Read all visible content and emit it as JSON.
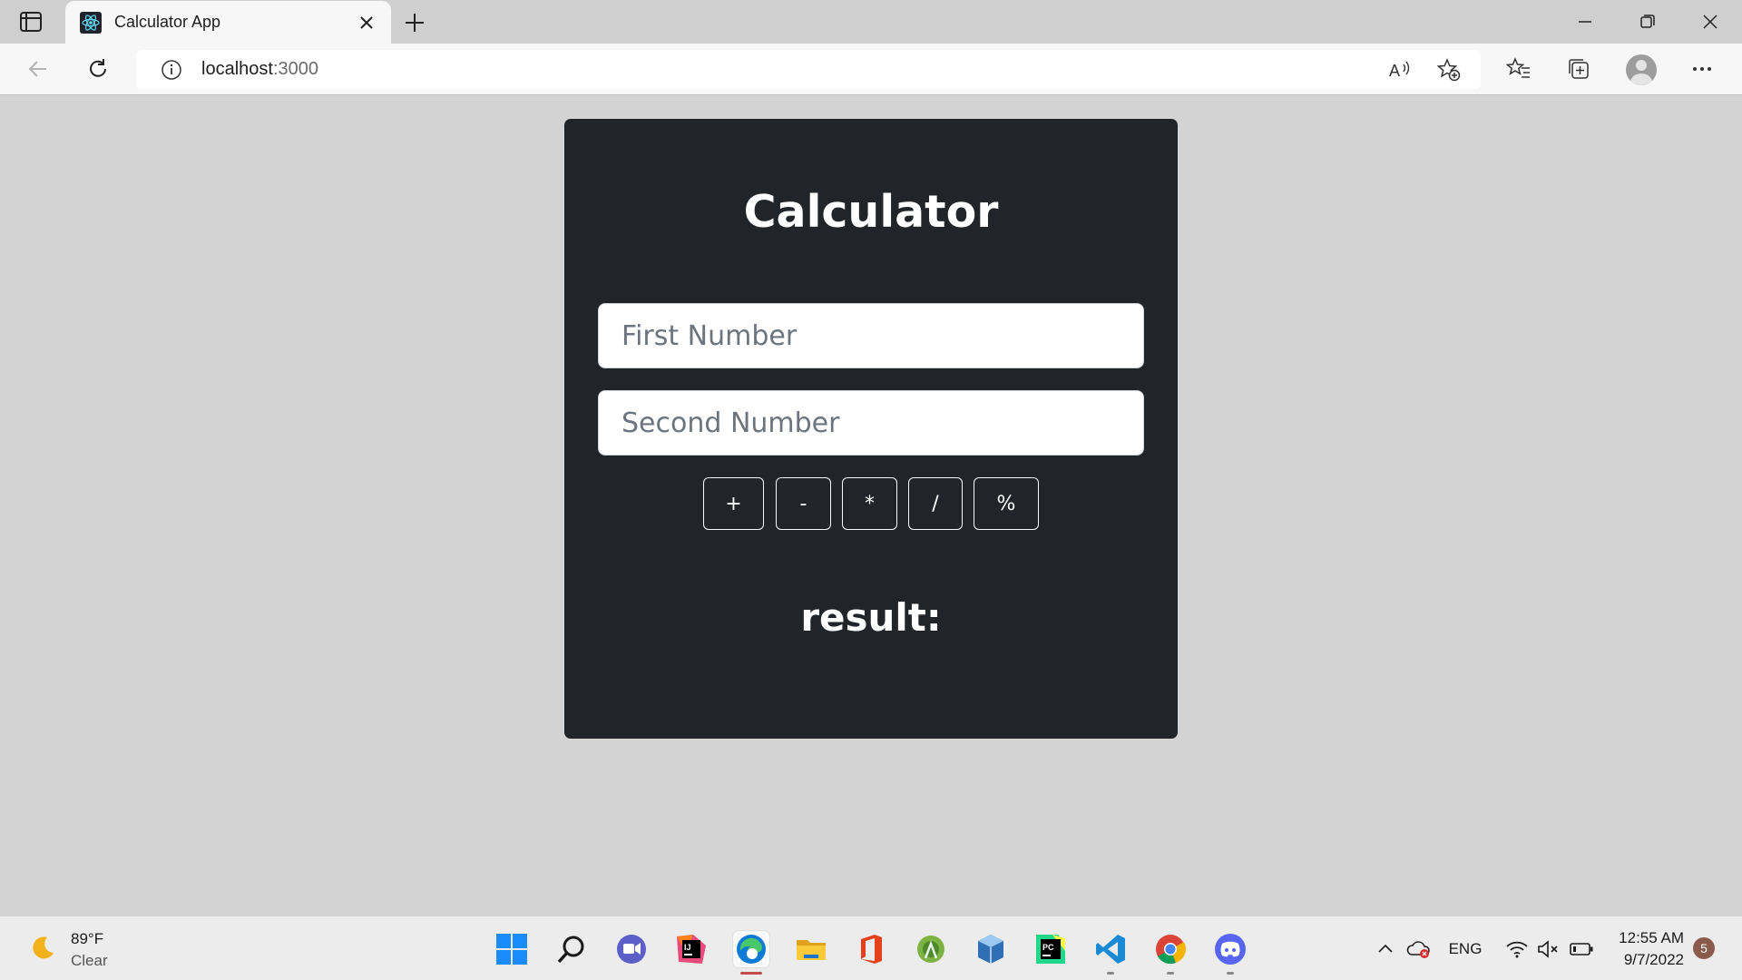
{
  "browser": {
    "tab_title": "Calculator App",
    "url_host": "localhost",
    "url_port": ":3000",
    "icons": {
      "tab_actions": "tab-actions-icon",
      "favicon": "react-icon",
      "close": "close-icon",
      "new_tab": "plus-icon",
      "back": "back-arrow-icon",
      "refresh": "refresh-icon",
      "info": "info-icon",
      "read_aloud": "read-aloud-icon",
      "add_favorite": "add-favorite-icon",
      "favorites": "favorites-icon",
      "collections": "collections-icon",
      "more": "more-icon"
    }
  },
  "calculator": {
    "title": "Calculator",
    "first_placeholder": "First Number",
    "second_placeholder": "Second Number",
    "operations": [
      "+",
      "-",
      "*",
      "/",
      "%"
    ],
    "result_label": "result:"
  },
  "taskbar": {
    "weather_temp": "89°F",
    "weather_condition": "Clear",
    "language": "ENG",
    "time": "12:55 AM",
    "date": "9/7/2022",
    "notification_count": "5",
    "apps": [
      "start",
      "search",
      "chat",
      "intellij",
      "edge",
      "file-explorer",
      "office",
      "android-studio",
      "virtualbox",
      "pycharm",
      "vscode",
      "chrome",
      "discord"
    ]
  },
  "colors": {
    "page_background": "#d3d3d3",
    "card_background": "#212529",
    "accent_edge": "#0f7bd6"
  }
}
